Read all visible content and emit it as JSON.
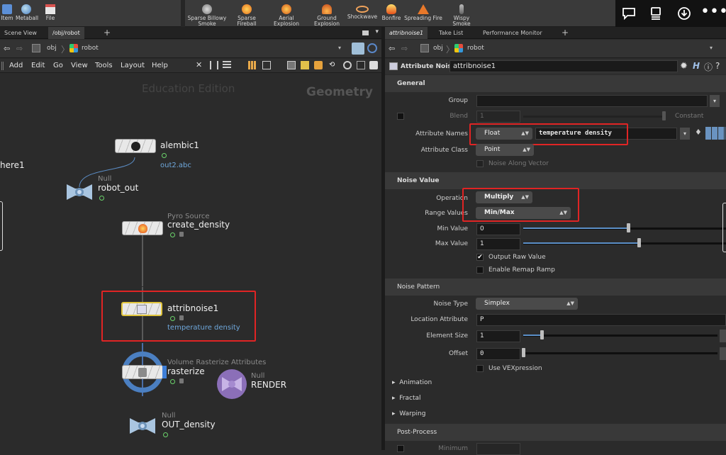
{
  "shelf": {
    "left_tools": [
      "Item",
      "Metaball",
      "File"
    ],
    "tools": [
      {
        "label1": "Sparse Billowy",
        "label2": "Smoke"
      },
      {
        "label1": "Sparse",
        "label2": "Fireball"
      },
      {
        "label1": "Aerial",
        "label2": "Explosion"
      },
      {
        "label1": "Ground",
        "label2": "Explosion"
      },
      {
        "label1": "Shockwave",
        "label2": ""
      },
      {
        "label1": "Bonfire",
        "label2": ""
      },
      {
        "label1": "Spreading Fire",
        "label2": ""
      },
      {
        "label1": "Wispy Smoke",
        "label2": ""
      }
    ]
  },
  "left": {
    "tabs": [
      "Scene View",
      "/obj/robot"
    ],
    "path": [
      "obj",
      "robot"
    ],
    "menu": [
      "Add",
      "Edit",
      "Go",
      "View",
      "Tools",
      "Layout",
      "Help"
    ],
    "watermark_edition": "Education Edition",
    "watermark_context": "Geometry",
    "partial_label": "here1",
    "nodes": {
      "alembic": {
        "name": "alembic1",
        "sub": "out2.abc"
      },
      "robot_out": {
        "type": "Null",
        "name": "robot_out"
      },
      "create_density": {
        "type": "Pyro Source",
        "name": "create_density"
      },
      "attribnoise": {
        "name": "attribnoise1",
        "sub": "temperature density"
      },
      "rasterize": {
        "type": "Volume Rasterize Attributes",
        "name": "rasterize"
      },
      "render": {
        "type": "Null",
        "name": "RENDER"
      },
      "out_density": {
        "type": "Null",
        "name": "OUT_density"
      }
    }
  },
  "right": {
    "tabs": [
      "attribnoise1",
      "Take List",
      "Performance Monitor"
    ],
    "path": [
      "obj",
      "robot"
    ],
    "node_type_label": "Attribute Noise",
    "node_name": "attribnoise1",
    "sections": {
      "general": "General",
      "noise_value": "Noise Value",
      "noise_pattern": "Noise Pattern",
      "post_process": "Post-Process"
    },
    "params": {
      "group_label": "Group",
      "blend_label": "Blend",
      "blend_value": "1",
      "blend_mode": "Constant",
      "attr_names_label": "Attribute Names",
      "attr_type": "Float",
      "attr_names_value": "temperature density",
      "attr_class_label": "Attribute Class",
      "attr_class_value": "Point",
      "noise_along_vector": "Noise Along Vector",
      "operation_label": "Operation",
      "operation_value": "Multiply",
      "range_values_label": "Range Values",
      "range_values_value": "Min/Max",
      "min_value_label": "Min Value",
      "min_value": "0",
      "max_value_label": "Max Value",
      "max_value": "1",
      "output_raw_value": "Output Raw Value",
      "enable_remap_ramp": "Enable Remap Ramp",
      "noise_type_label": "Noise Type",
      "noise_type_value": "Simplex",
      "location_attr_label": "Location Attribute",
      "location_attr_value": "P",
      "element_size_label": "Element Size",
      "element_size_value": "1",
      "offset_label": "Offset",
      "offset_value": "0",
      "use_vexpression": "Use VEXpression",
      "minimum_label": "Minimum"
    },
    "collapsed": [
      "Animation",
      "Fractal",
      "Warping"
    ]
  },
  "colors": {
    "highlight": "#e02424",
    "accent_blue": "#6fa8dc",
    "flag_green": "#6bd36b"
  }
}
